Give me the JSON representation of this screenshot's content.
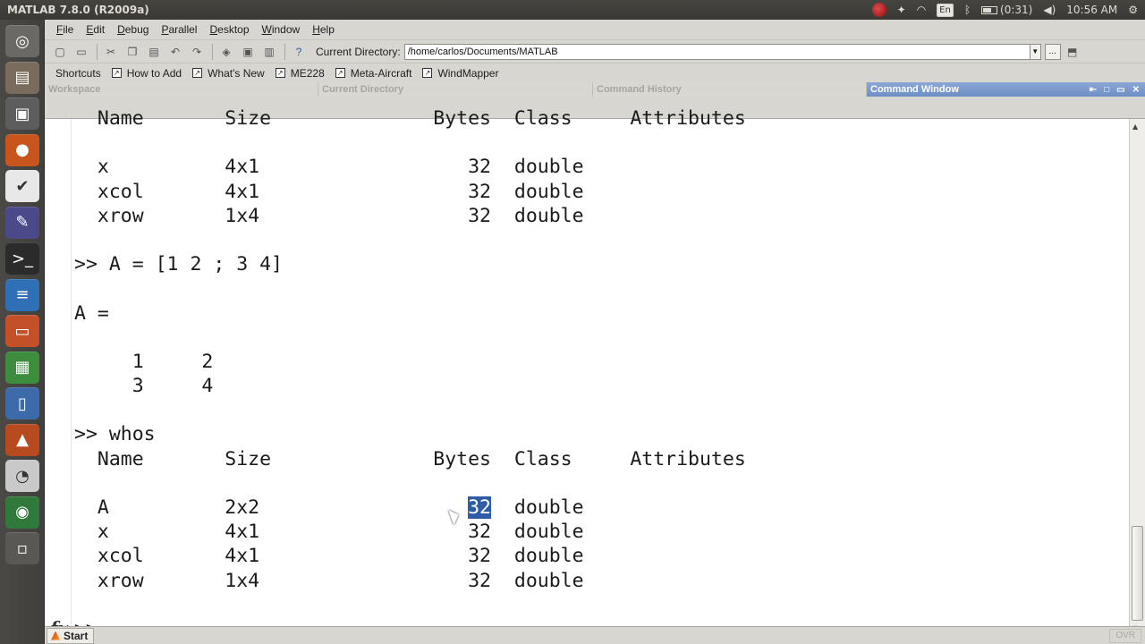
{
  "top_panel": {
    "title": "MATLAB  7.8.0 (R2009a)",
    "language": "En",
    "battery": "(0:31)",
    "clock": "10:56 AM"
  },
  "launcher": {
    "items": [
      {
        "name": "dash-icon",
        "color": "#6a6963",
        "glyph": "◎"
      },
      {
        "name": "files-icon",
        "color": "#7a6c5d",
        "glyph": "▤"
      },
      {
        "name": "camera-icon",
        "color": "#5d5d5d",
        "glyph": "▣"
      },
      {
        "name": "firefox-icon",
        "color": "#c8561c",
        "glyph": "●"
      },
      {
        "name": "checkbox-app-icon",
        "color": "#e8e8e8",
        "glyph": "✔"
      },
      {
        "name": "gimp-icon",
        "color": "#4a4a8a",
        "glyph": "✎"
      },
      {
        "name": "terminal-icon",
        "color": "#2b2b2b",
        "glyph": ">_"
      },
      {
        "name": "writer-icon",
        "color": "#2f6fb5",
        "glyph": "≡"
      },
      {
        "name": "impress-icon",
        "color": "#c4502a",
        "glyph": "▭"
      },
      {
        "name": "calc-icon",
        "color": "#3e8d3e",
        "glyph": "▦"
      },
      {
        "name": "document-viewer-icon",
        "color": "#3d6aa8",
        "glyph": "▯"
      },
      {
        "name": "matlab-icon",
        "color": "#b84a1f",
        "glyph": "▲"
      },
      {
        "name": "presentation-icon",
        "color": "#c9c9c9",
        "glyph": "◔"
      },
      {
        "name": "globe-icon",
        "color": "#2f7a3a",
        "glyph": "◉"
      },
      {
        "name": "workspace-switcher-icon",
        "color": "#595853",
        "glyph": "▫"
      }
    ]
  },
  "menubar": {
    "items": [
      {
        "key": "F",
        "rest": "ile"
      },
      {
        "key": "E",
        "rest": "dit"
      },
      {
        "key": "D",
        "rest": "ebug"
      },
      {
        "key": "P",
        "rest": "arallel"
      },
      {
        "key": "D",
        "rest": "esktop"
      },
      {
        "key": "W",
        "rest": "indow"
      },
      {
        "key": "H",
        "rest": "elp"
      }
    ]
  },
  "toolbar": {
    "current_directory_label": "Current Directory:",
    "current_directory_value": "/home/carlos/Documents/MATLAB",
    "browse_label": "..."
  },
  "shortcuts": {
    "items": [
      "Shortcuts",
      "How to Add",
      "What's New",
      "ME228",
      "Meta-Aircraft",
      "WindMapper"
    ]
  },
  "dock_tabs": {
    "workspace": "Workspace",
    "current_directory": "Current Directory",
    "command_history": "Command History",
    "command_window": "Command Window"
  },
  "command_window": {
    "lines": [
      "  Name       Size              Bytes  Class     Attributes",
      "",
      "  x          4x1                  32  double",
      "  xcol       4x1                  32  double",
      "  xrow       1x4                  32  double",
      "",
      ">> A = [1 2 ; 3 4]",
      "",
      "A =",
      "",
      "     1     2",
      "     3     4",
      "",
      ">> whos",
      "  Name       Size              Bytes  Class     Attributes",
      "",
      "  A          2x2                  ",
      "  x          4x1                  32  double",
      "  xcol       4x1                  32  double",
      "  xrow       1x4                  32  double",
      "",
      ">> "
    ],
    "selected_text": "32",
    "selected_line_rest": "  double",
    "fx_label": "fx"
  },
  "status": {
    "start_label": "Start",
    "ovr_label": "OVR"
  }
}
